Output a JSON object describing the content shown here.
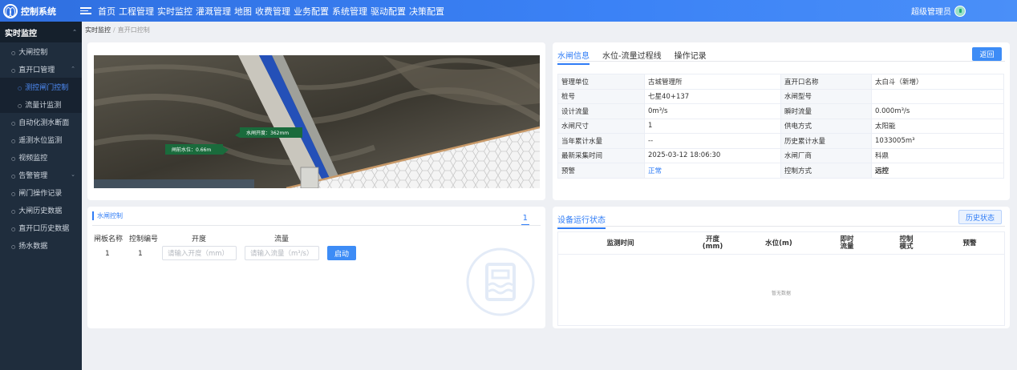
{
  "app": {
    "title": "控制系统",
    "user": "超级管理员"
  },
  "nav": [
    "首页",
    "工程管理",
    "实时监控",
    "灌溉管理",
    "地图",
    "收费管理",
    "业务配置",
    "系统管理",
    "驱动配置",
    "决策配置"
  ],
  "sidebar": {
    "header": "实时监控",
    "items": [
      "大闸控制",
      "直开口管理",
      "测控闸门控制",
      "流量计监测",
      "自动化测水断面",
      "遥测水位监测",
      "视频监控",
      "告警管理",
      "闸门操作记录",
      "大闸历史数据",
      "直开口历史数据",
      "扬水数据"
    ]
  },
  "breadcrumb": {
    "root": "实时监控",
    "current": "直开口控制"
  },
  "scene": {
    "label_opening": "水闸开度：362mm",
    "label_level": "闸前水位：0.66m"
  },
  "info": {
    "tabs": [
      "水闸信息",
      "水位-流量过程线",
      "操作记录"
    ],
    "back": "返回",
    "rows": [
      [
        "管理单位",
        "古城管理所",
        "直开口名称",
        "太白斗（新增）"
      ],
      [
        "桩号",
        "七星40+137",
        "水闸型号",
        ""
      ],
      [
        "设计流量",
        "0m³/s",
        "瞬时流量",
        "0.000m³/s"
      ],
      [
        "水闸尺寸",
        "1",
        "供电方式",
        "太阳能"
      ],
      [
        "当年累计水量",
        "--",
        "历史累计水量",
        "1033005m³"
      ],
      [
        "最新采集时间",
        "2025-03-12 18:06:30",
        "水闸厂商",
        "科鼎"
      ],
      [
        "预警",
        "正常",
        "控制方式",
        "远控"
      ]
    ]
  },
  "control": {
    "title": "水闸控制",
    "page": "1",
    "columns": [
      "闸板名称",
      "控制编号",
      "开度",
      "流量"
    ],
    "row": {
      "name": "1",
      "code": "1"
    },
    "opening_placeholder": "请输入开度（mm）",
    "flow_placeholder": "请输入流量（m³/s）",
    "start": "启动"
  },
  "status": {
    "title": "设备运行状态",
    "history": "历史状态",
    "columns": [
      "监测时间",
      "开度\n(mm)",
      "水位(m)",
      "即时\n流量",
      "控制\n模式",
      "预警"
    ],
    "empty": "暂无数据"
  },
  "colors": {
    "primary": "#3d8cf6",
    "sidebar": "#1f2d3d",
    "topbar": "#3b82f6"
  }
}
